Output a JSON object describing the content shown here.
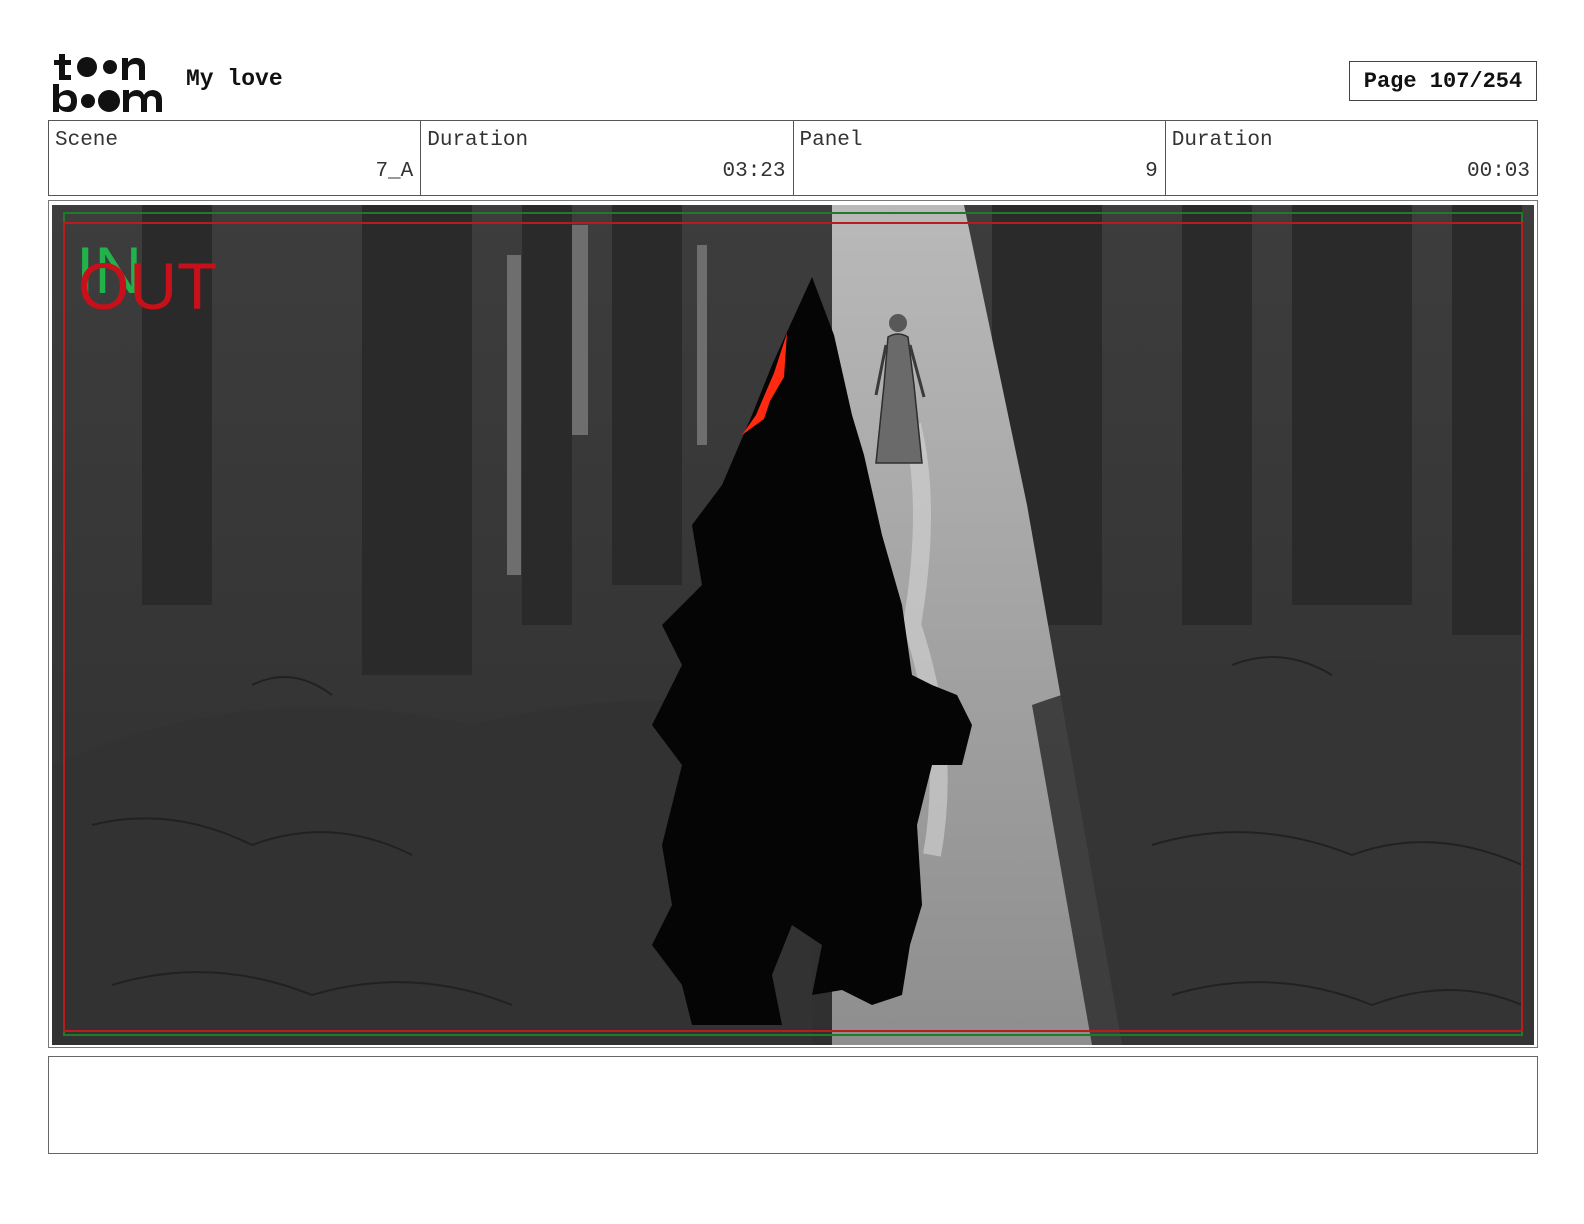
{
  "header": {
    "logo": {
      "top_word": "toon",
      "bottom_word": "boom"
    },
    "project_title": "My love",
    "page_label": "Page 107/254"
  },
  "info": {
    "scene_label": "Scene",
    "scene_value": "7_A",
    "scene_duration_label": "Duration",
    "scene_duration_value": "03:23",
    "panel_label": "Panel",
    "panel_value": "9",
    "panel_duration_label": "Duration",
    "panel_duration_value": "00:03"
  },
  "panel": {
    "in_marker": "IN",
    "out_marker": "OUT",
    "colors": {
      "in_marker": "#22b24c",
      "out_marker": "#c8101a",
      "safe_frame": "#1f7a2a",
      "action_frame": "#b81c1c",
      "eye_glow": "#ff2a10"
    }
  },
  "notes": {
    "text": ""
  }
}
